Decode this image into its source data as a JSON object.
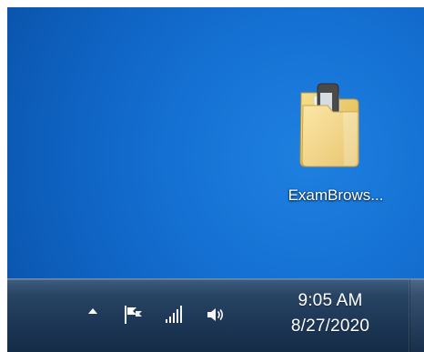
{
  "desktop": {
    "icons": [
      {
        "label": "ExamBrows...",
        "icon": "folder-icon"
      }
    ]
  },
  "taskbar": {
    "tray_icons": [
      {
        "name": "show-hidden-icons-icon"
      },
      {
        "name": "flag-icon"
      },
      {
        "name": "network-signal-icon"
      },
      {
        "name": "volume-icon"
      }
    ],
    "clock": {
      "time": "9:05 AM",
      "date": "8/27/2020"
    }
  },
  "colors": {
    "desktop_blue": "#1572d4",
    "taskbar_navy": "#1c3655",
    "text_white": "#ffffff"
  }
}
